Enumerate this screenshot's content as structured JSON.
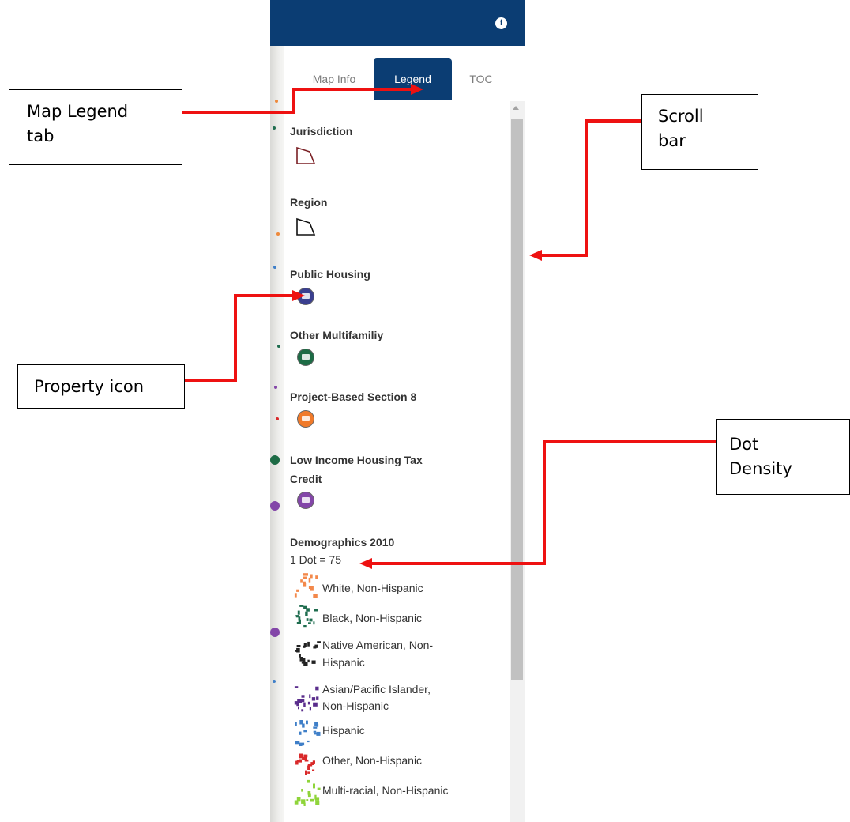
{
  "panel": {
    "tabs": [
      {
        "label": "Map Info",
        "active": false
      },
      {
        "label": "Legend",
        "active": true
      },
      {
        "label": "TOC",
        "active": false
      }
    ],
    "info_icon": "info-icon",
    "accent_color": "#0b3d73"
  },
  "legend": {
    "jurisdiction": {
      "title": "Jurisdiction",
      "symbol": "polygon-outline-dark-red"
    },
    "region": {
      "title": "Region",
      "symbol": "polygon-outline-black"
    },
    "public_housing": {
      "title": "Public Housing",
      "color": "#3a3f8f"
    },
    "other_multifamily": {
      "title": "Other Multifamiliy",
      "color": "#1d6b45"
    },
    "project_based": {
      "title": "Project-Based Section 8",
      "color": "#f07a2a"
    },
    "lihtc": {
      "title_line1": "Low Income Housing Tax",
      "title_line2": "Credit",
      "color": "#8346a8"
    },
    "demographics": {
      "title": "Demographics 2010",
      "density": "1 Dot = 75",
      "items": [
        {
          "line1": "White, Non-Hispanic",
          "line2": "",
          "color": "#f3884a"
        },
        {
          "line1": "Black, Non-Hispanic",
          "line2": "",
          "color": "#1f6d4f"
        },
        {
          "line1": "Native American, Non-",
          "line2": "Hispanic",
          "color": "#222222"
        },
        {
          "line1": "Asian/Pacific Islander,",
          "line2": "Non-Hispanic",
          "color": "#5a2d8c"
        },
        {
          "line1": "Hispanic",
          "line2": "",
          "color": "#3f7fc8"
        },
        {
          "line1": "Other, Non-Hispanic",
          "line2": "",
          "color": "#d9292a"
        },
        {
          "line1": "Multi-racial, Non-Hispanic",
          "line2": "",
          "color": "#8fd43a"
        }
      ]
    }
  },
  "callouts": {
    "legend_tab_line1": "Map Legend",
    "legend_tab_line2": "tab",
    "scroll_line1": "Scroll",
    "scroll_line2": "bar",
    "property_icon": "Property icon",
    "dot_line1": "Dot",
    "dot_line2": "Density"
  },
  "arrow_color": "#ee1111"
}
